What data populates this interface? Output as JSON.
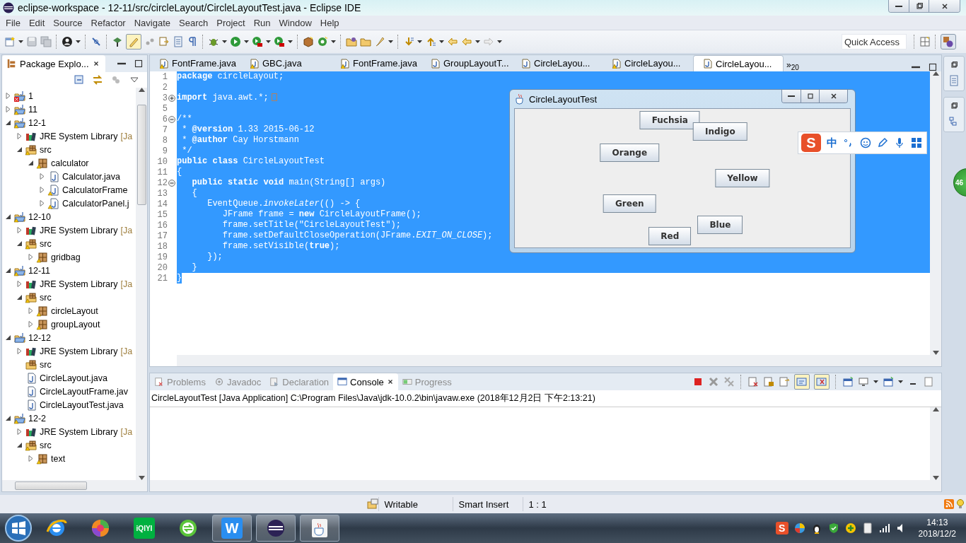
{
  "window": {
    "title": "eclipse-workspace - 12-11/src/circleLayout/CircleLayoutTest.java - Eclipse IDE"
  },
  "menu": [
    "File",
    "Edit",
    "Source",
    "Refactor",
    "Navigate",
    "Search",
    "Project",
    "Run",
    "Window",
    "Help"
  ],
  "quick_access": {
    "placeholder": "Quick Access"
  },
  "package_explorer": {
    "title": "Package Explo...",
    "tree": [
      {
        "label": "1",
        "kind": "project",
        "expanded": false,
        "error": true
      },
      {
        "label": "11",
        "kind": "project",
        "expanded": false,
        "warning": true
      },
      {
        "label": "12-1",
        "kind": "project",
        "expanded": true,
        "warning": true,
        "children": [
          {
            "label": "JRE System Library",
            "decoration": "[Ja",
            "kind": "library",
            "expanded": false,
            "warning": false
          },
          {
            "label": "src",
            "kind": "source",
            "expanded": true,
            "warning": true,
            "children": [
              {
                "label": "calculator",
                "kind": "package",
                "expanded": true,
                "warning": true,
                "children": [
                  {
                    "label": "Calculator.java",
                    "kind": "file",
                    "expanded": false,
                    "warning": false
                  },
                  {
                    "label": "CalculatorFrame",
                    "kind": "file",
                    "expanded": false,
                    "warning": true
                  },
                  {
                    "label": "CalculatorPanel.j",
                    "kind": "file",
                    "expanded": false,
                    "warning": true
                  }
                ]
              }
            ]
          }
        ]
      },
      {
        "label": "12-10",
        "kind": "project",
        "expanded": true,
        "warning": true,
        "children": [
          {
            "label": "JRE System Library",
            "decoration": "[Ja",
            "kind": "library",
            "expanded": false,
            "warning": false
          },
          {
            "label": "src",
            "kind": "source",
            "expanded": true,
            "warning": true,
            "children": [
              {
                "label": "gridbag",
                "kind": "package",
                "expanded": false,
                "warning": true
              }
            ]
          }
        ]
      },
      {
        "label": "12-11",
        "kind": "project",
        "expanded": true,
        "warning": true,
        "children": [
          {
            "label": "JRE System Library",
            "decoration": "[Ja",
            "kind": "library",
            "expanded": false,
            "warning": false
          },
          {
            "label": "src",
            "kind": "source",
            "expanded": true,
            "warning": true,
            "children": [
              {
                "label": "circleLayout",
                "kind": "package",
                "expanded": false,
                "warning": true
              },
              {
                "label": "groupLayout",
                "kind": "package",
                "expanded": false,
                "warning": true
              }
            ]
          }
        ]
      },
      {
        "label": "12-12",
        "kind": "project",
        "expanded": true,
        "warning": false,
        "children": [
          {
            "label": "JRE System Library",
            "decoration": "[Ja",
            "kind": "library",
            "expanded": false,
            "warning": false
          },
          {
            "label": "src",
            "kind": "source",
            "warning": false
          },
          {
            "label": "CircleLayout.java",
            "kind": "file",
            "warning": false
          },
          {
            "label": "CircleLayoutFrame.jav",
            "kind": "file",
            "warning": false
          },
          {
            "label": "CircleLayoutTest.java",
            "kind": "file",
            "warning": false
          }
        ]
      },
      {
        "label": "12-2",
        "kind": "project",
        "expanded": true,
        "warning": true,
        "children": [
          {
            "label": "JRE System Library",
            "decoration": "[Ja",
            "kind": "library",
            "expanded": false,
            "warning": false
          },
          {
            "label": "src",
            "kind": "source",
            "expanded": true,
            "warning": true,
            "children": [
              {
                "label": "text",
                "kind": "package",
                "expanded": false,
                "warning": true
              }
            ]
          }
        ]
      }
    ]
  },
  "editor": {
    "tabs": [
      {
        "label": "FontFrame.java",
        "warning": true,
        "selected": false
      },
      {
        "label": "GBC.java",
        "warning": true,
        "selected": false
      },
      {
        "label": "FontFrame.java",
        "warning": true,
        "selected": false
      },
      {
        "label": "GroupLayoutT...",
        "warning": false,
        "selected": false
      },
      {
        "label": "CircleLayou...",
        "warning": false,
        "selected": false
      },
      {
        "label": "CircleLayou...",
        "warning": true,
        "selected": false
      },
      {
        "label": "CircleLayou...",
        "warning": false,
        "selected": true
      }
    ],
    "overflow": "»$_{20}$",
    "lines": [
      {
        "number": "1",
        "text": "**package** circleLayout;",
        "selected": true,
        "whole_line": true
      },
      {
        "number": "2",
        "selected": true,
        "whole_line": true
      },
      {
        "number": "3",
        "text": "**import** java.awt.*;",
        "folded": true,
        "selected": true,
        "whole_line": true
      },
      {
        "number": "5",
        "selected": true,
        "whole_line": true
      },
      {
        "number": "6",
        "text": "/**",
        "folded": false,
        "selected": true,
        "whole_line": true
      },
      {
        "number": "7",
        "text": " * **@version** 1.33 2015-06-12",
        "selected": true,
        "whole_line": true
      },
      {
        "number": "8",
        "text": " * **@author** Cay Horstmann",
        "selected": true,
        "whole_line": true
      },
      {
        "number": "9",
        "text": " */",
        "selected": true,
        "whole_line": true
      },
      {
        "number": "10",
        "text": "**public** **class** CircleLayoutTest",
        "selected": true,
        "whole_line": true
      },
      {
        "number": "11",
        "text": "{",
        "selected": true,
        "whole_line": true
      },
      {
        "number": "12",
        "text": "   **public** **static** **void** main(String[] args)",
        "folded": false,
        "selected": true,
        "whole_line": true
      },
      {
        "number": "13",
        "text": "   {",
        "selected": true,
        "whole_line": true
      },
      {
        "number": "14",
        "text": "      EventQueue.*invokeLater*(() -> {",
        "selected": true,
        "whole_line": true
      },
      {
        "number": "15",
        "text": "         JFrame frame = **new** CircleLayoutFrame();",
        "selected": true,
        "whole_line": true
      },
      {
        "number": "16",
        "text": "         frame.setTitle(\"CircleLayoutTest\");",
        "selected": true,
        "whole_line": true
      },
      {
        "number": "17",
        "text": "         frame.setDefaultCloseOperation(JFrame.*EXIT_ON_CLOSE*);",
        "selected": true,
        "whole_line": true
      },
      {
        "number": "18",
        "text": "         frame.setVisible(**true**);",
        "selected": true,
        "whole_line": true
      },
      {
        "number": "19",
        "text": "      });",
        "selected": true,
        "whole_line": true
      },
      {
        "number": "20",
        "text": "   }",
        "selected": true,
        "whole_line": true
      },
      {
        "number": "21",
        "text": "}",
        "selected": true,
        "whole_line": false
      }
    ]
  },
  "app_window": {
    "title": "CircleLayoutTest",
    "buttons": [
      "Yellow",
      "Blue",
      "Red",
      "Green",
      "Orange",
      "Fuchsia",
      "Indigo"
    ]
  },
  "ime_bar": {
    "logo": "S",
    "mode": "中"
  },
  "floating_badge": {
    "text": "46"
  },
  "console": {
    "tabs": [
      {
        "label": "Problems",
        "selected": false
      },
      {
        "label": "Javadoc",
        "selected": false
      },
      {
        "label": "Declaration",
        "selected": false
      },
      {
        "label": "Console",
        "selected": true
      },
      {
        "label": "Progress",
        "selected": false
      }
    ],
    "launch": "CircleLayoutTest [Java Application] C:\\Program Files\\Java\\jdk-10.0.2\\bin\\javaw.exe (2018年12月2日 下午2:13:21)"
  },
  "status_bar": {
    "fields": [
      "Writable",
      "Smart Insert",
      "1 : 1"
    ]
  },
  "taskbar": {
    "apps": [
      {
        "kind": "browser",
        "running": false
      },
      {
        "kind": "ball",
        "running": false
      },
      {
        "kind": "video",
        "label": "iQIYI",
        "running": false
      },
      {
        "kind": "sync",
        "running": false
      },
      {
        "kind": "writer",
        "label": "W",
        "running": true
      },
      {
        "kind": "eclipse",
        "running": true
      },
      {
        "kind": "java",
        "running": true
      }
    ],
    "tray_ime": "S",
    "time": "14:13",
    "date": "2018/12/2"
  }
}
